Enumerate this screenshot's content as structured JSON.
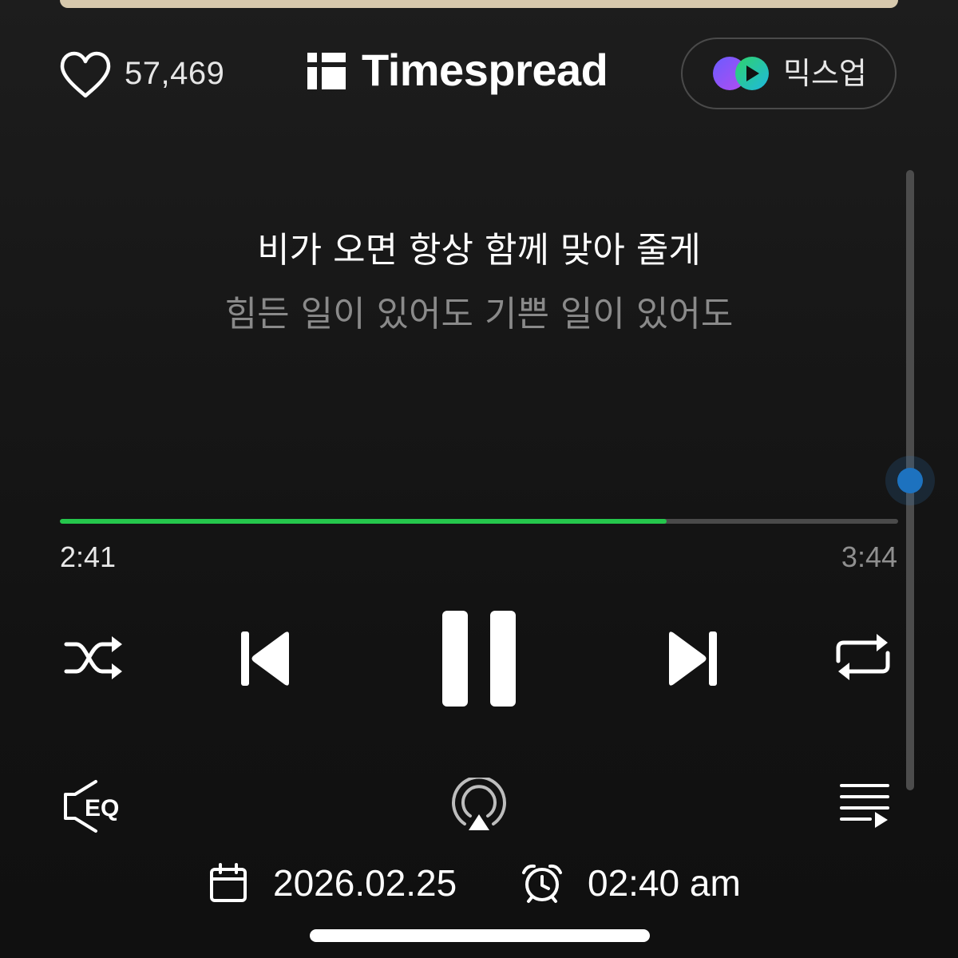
{
  "header": {
    "like_count": "57,469",
    "brand_name": "Timespread",
    "mixup_label": "믹스업"
  },
  "lyrics": {
    "current": "비가 오면 항상 함께 맞아 줄게",
    "next": "힘든 일이 있어도 기쁜 일이 있어도"
  },
  "player": {
    "elapsed": "2:41",
    "total": "3:44",
    "progress_fraction": 0.724
  },
  "controls": {
    "shuffle": "shuffle-icon",
    "previous": "skip-previous-icon",
    "pause": "pause-icon",
    "next": "skip-next-icon",
    "repeat": "repeat-icon",
    "eq_label": "EQ",
    "airplay": "airplay-icon",
    "queue": "playlist-queue-icon"
  },
  "info": {
    "date": "2026.02.25",
    "time": "02:40 am"
  },
  "colors": {
    "background": "#111111",
    "progress_fill": "#25c64c",
    "scroll_thumb": "#1d72bf",
    "secondary_text": "#8a8a8a"
  }
}
